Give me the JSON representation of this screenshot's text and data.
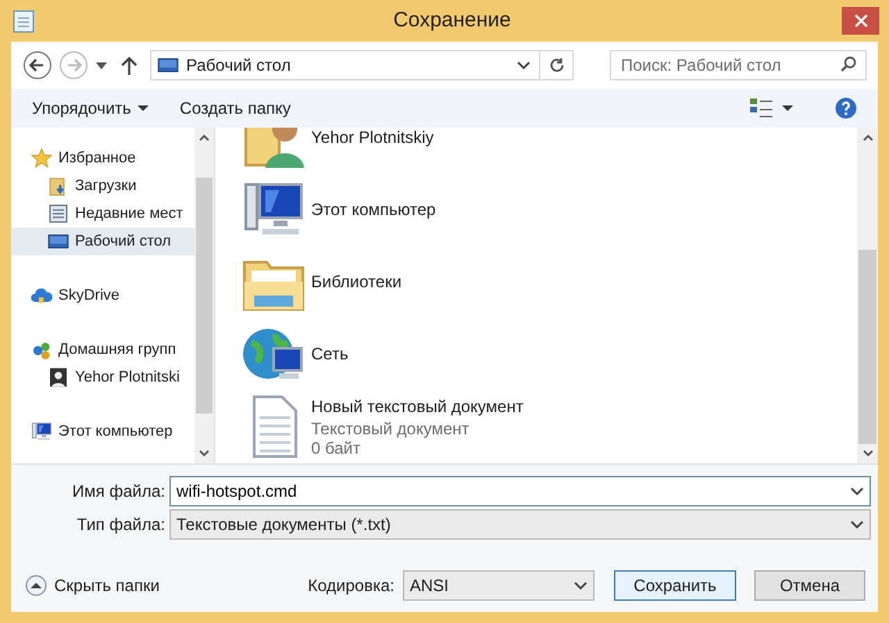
{
  "window": {
    "title": "Сохранение"
  },
  "address": {
    "location": "Рабочий стол"
  },
  "search": {
    "placeholder": "Поиск: Рабочий стол"
  },
  "toolbar": {
    "organize": "Упорядочить",
    "new_folder": "Создать папку"
  },
  "sidebar": {
    "groups": [
      {
        "label": "Избранное",
        "kind": "star",
        "selected": false,
        "children": [
          {
            "label": "Загрузки",
            "kind": "downloads",
            "selected": false
          },
          {
            "label": "Недавние мест",
            "kind": "recent",
            "selected": false
          },
          {
            "label": "Рабочий стол",
            "kind": "desktop",
            "selected": true
          }
        ]
      },
      {
        "label": "SkyDrive",
        "kind": "cloud",
        "selected": false
      },
      {
        "label": "Домашняя групп",
        "kind": "homegroup",
        "selected": false,
        "children": [
          {
            "label": "Yehor Plotnitski",
            "kind": "user",
            "selected": false
          }
        ]
      },
      {
        "label": "Этот компьютер",
        "kind": "computer",
        "selected": false
      }
    ]
  },
  "files": [
    {
      "name": "Yehor Plotnitskiy",
      "kind": "user-folder"
    },
    {
      "name": "Этот компьютер",
      "kind": "computer"
    },
    {
      "name": "Библиотеки",
      "kind": "library"
    },
    {
      "name": "Сеть",
      "kind": "network"
    },
    {
      "name": "Новый текстовый документ",
      "kind": "text-file",
      "details": [
        "Текстовый документ",
        "0 байт"
      ]
    }
  ],
  "form": {
    "file_name_label": "Имя файла:",
    "file_name": "wifi-hotspot.cmd",
    "file_type_label": "Тип файла:",
    "file_type": "Текстовые документы (*.txt)"
  },
  "footer": {
    "hide_folders": "Скрыть папки",
    "encoding_label": "Кодировка:",
    "encoding": "ANSI",
    "save": "Сохранить",
    "cancel": "Отмена"
  }
}
